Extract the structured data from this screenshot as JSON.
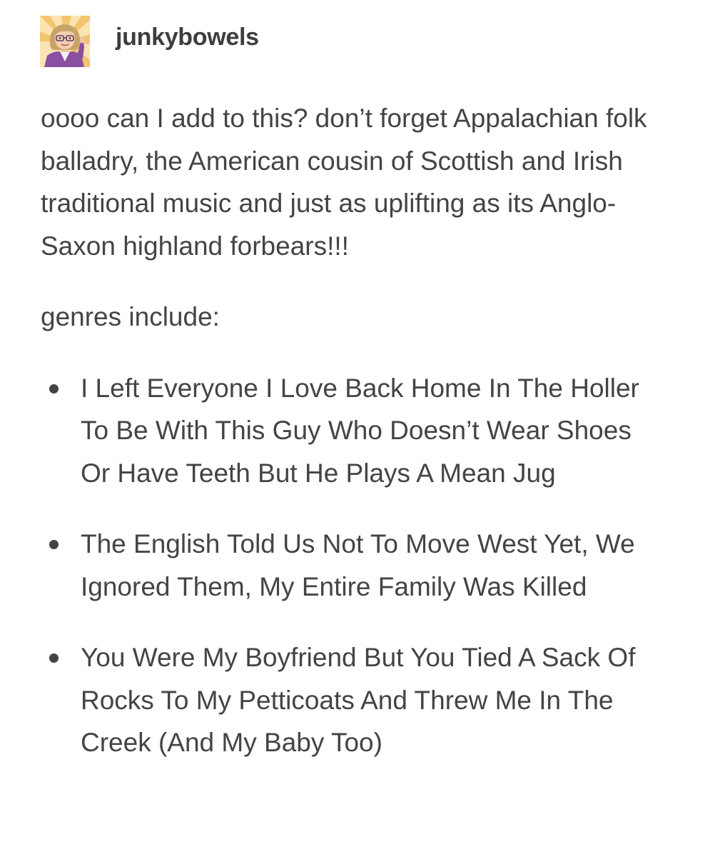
{
  "post": {
    "username": "junkybowels",
    "avatar_icon": "bitmoji-avatar-icon",
    "intro": "oooo can I add to this? don’t forget Appalachian folk balladry, the American cousin of Scottish and Irish traditional music and just as uplifting as its Anglo-Saxon highland forbears!!!",
    "genres_intro": "genres include:",
    "genres": [
      "I Left Everyone I Love Back Home In The Holler To Be With This Guy Who Doesn’t Wear Shoes Or Have Teeth But He Plays A Mean Jug",
      "The English Told Us Not To Move West Yet, We Ignored Them, My Entire Family Was Killed",
      "You Were My Boyfriend But You Tied A Sack Of Rocks To My Petticoats And Threw Me In The Creek (And My Baby Too)"
    ]
  },
  "colors": {
    "text": "#444444",
    "username": "#3d3d3d",
    "avatar_bg": "#f6d38b",
    "avatar_hair": "#c9a46a",
    "avatar_jacket": "#8a4fa0"
  }
}
